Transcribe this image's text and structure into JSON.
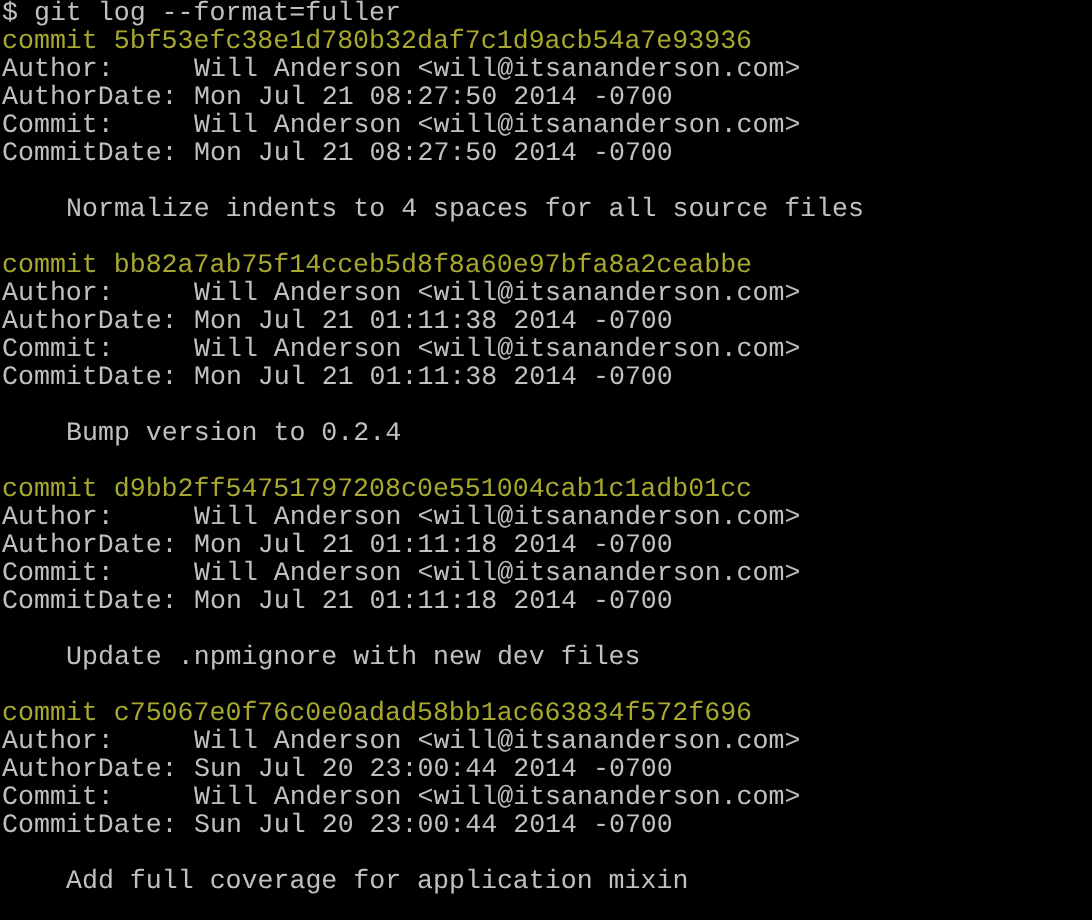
{
  "prompt": "$ git log --format=fuller",
  "commits": [
    {
      "hash_line": "commit 5bf53efc38e1d780b32daf7c1d9acb54a7e93936",
      "fields": [
        {
          "label": "Author:",
          "value": "Will Anderson <will@itsananderson.com>"
        },
        {
          "label": "AuthorDate:",
          "value": "Mon Jul 21 08:27:50 2014 -0700"
        },
        {
          "label": "Commit:",
          "value": "Will Anderson <will@itsananderson.com>"
        },
        {
          "label": "CommitDate:",
          "value": "Mon Jul 21 08:27:50 2014 -0700"
        }
      ],
      "message": "Normalize indents to 4 spaces for all source files"
    },
    {
      "hash_line": "commit bb82a7ab75f14cceb5d8f8a60e97bfa8a2ceabbe",
      "fields": [
        {
          "label": "Author:",
          "value": "Will Anderson <will@itsananderson.com>"
        },
        {
          "label": "AuthorDate:",
          "value": "Mon Jul 21 01:11:38 2014 -0700"
        },
        {
          "label": "Commit:",
          "value": "Will Anderson <will@itsananderson.com>"
        },
        {
          "label": "CommitDate:",
          "value": "Mon Jul 21 01:11:38 2014 -0700"
        }
      ],
      "message": "Bump version to 0.2.4"
    },
    {
      "hash_line": "commit d9bb2ff54751797208c0e551004cab1c1adb01cc",
      "fields": [
        {
          "label": "Author:",
          "value": "Will Anderson <will@itsananderson.com>"
        },
        {
          "label": "AuthorDate:",
          "value": "Mon Jul 21 01:11:18 2014 -0700"
        },
        {
          "label": "Commit:",
          "value": "Will Anderson <will@itsananderson.com>"
        },
        {
          "label": "CommitDate:",
          "value": "Mon Jul 21 01:11:18 2014 -0700"
        }
      ],
      "message": "Update .npmignore with new dev files"
    },
    {
      "hash_line": "commit c75067e0f76c0e0adad58bb1ac663834f572f696",
      "fields": [
        {
          "label": "Author:",
          "value": "Will Anderson <will@itsananderson.com>"
        },
        {
          "label": "AuthorDate:",
          "value": "Sun Jul 20 23:00:44 2014 -0700"
        },
        {
          "label": "Commit:",
          "value": "Will Anderson <will@itsananderson.com>"
        },
        {
          "label": "CommitDate:",
          "value": "Sun Jul 20 23:00:44 2014 -0700"
        }
      ],
      "message": "Add full coverage for application mixin"
    }
  ]
}
